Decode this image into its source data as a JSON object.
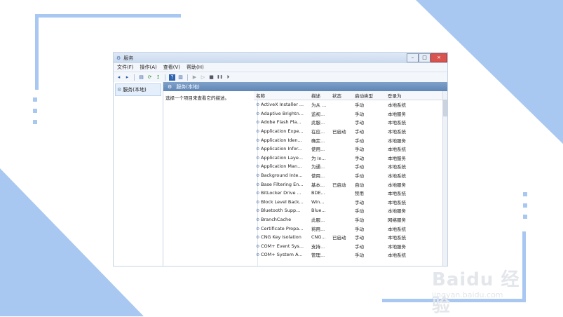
{
  "window": {
    "title": "服务",
    "controls": {
      "minimize": "–",
      "maximize": "□",
      "close": "×"
    }
  },
  "menu": [
    "文件(F)",
    "操作(A)",
    "查看(V)",
    "帮助(H)"
  ],
  "toolbar": {
    "icons": [
      "back-icon",
      "forward-icon",
      "console-tree-icon",
      "refresh-icon",
      "export-icon",
      "help-icon",
      "properties-icon",
      "start-icon",
      "play-icon",
      "stop-icon",
      "pause-icon",
      "restart-icon"
    ],
    "glyphs": {
      "back": "◂",
      "forward": "▸",
      "tree": "▤",
      "refresh": "⟳",
      "export": "↥",
      "help": "?",
      "props": "▥",
      "play": "▶",
      "play2": "▷",
      "stop": "■",
      "pause": "❚❚",
      "restart": "⏵"
    }
  },
  "left_pane": {
    "tree_item": "服务(本地)"
  },
  "right_pane": {
    "header": "服务(本地)",
    "description": "选择一个项目来查看它的描述。",
    "columns": [
      "名称",
      "描述",
      "状态",
      "启动类型",
      "登录为"
    ],
    "rows": [
      {
        "name": "ActiveX Installer ...",
        "desc": "为从 ...",
        "status": "",
        "start": "手动",
        "logon": "本地系统"
      },
      {
        "name": "Adaptive Brightn...",
        "desc": "监视...",
        "status": "",
        "start": "手动",
        "logon": "本地服务"
      },
      {
        "name": "Adobe Flash Pla...",
        "desc": "此服...",
        "status": "",
        "start": "手动",
        "logon": "本地系统"
      },
      {
        "name": "Application Expe...",
        "desc": "在应...",
        "status": "已启动",
        "start": "手动",
        "logon": "本地系统"
      },
      {
        "name": "Application Iden...",
        "desc": "确定...",
        "status": "",
        "start": "手动",
        "logon": "本地服务"
      },
      {
        "name": "Application Infor...",
        "desc": "使用...",
        "status": "",
        "start": "手动",
        "logon": "本地系统"
      },
      {
        "name": "Application Laye...",
        "desc": "为 In...",
        "status": "",
        "start": "手动",
        "logon": "本地服务"
      },
      {
        "name": "Application Man...",
        "desc": "为通...",
        "status": "",
        "start": "手动",
        "logon": "本地系统"
      },
      {
        "name": "Background Inte...",
        "desc": "使用...",
        "status": "",
        "start": "手动",
        "logon": "本地系统"
      },
      {
        "name": "Base Filtering En...",
        "desc": "基本...",
        "status": "已启动",
        "start": "自动",
        "logon": "本地服务"
      },
      {
        "name": "BitLocker Drive ...",
        "desc": "BDE...",
        "status": "",
        "start": "禁用",
        "logon": "本地系统"
      },
      {
        "name": "Block Level Back...",
        "desc": "Win...",
        "status": "",
        "start": "手动",
        "logon": "本地系统"
      },
      {
        "name": "Bluetooth Supp...",
        "desc": "Blue...",
        "status": "",
        "start": "手动",
        "logon": "本地服务"
      },
      {
        "name": "BranchCache",
        "desc": "此服...",
        "status": "",
        "start": "手动",
        "logon": "网络服务"
      },
      {
        "name": "Certificate Propa...",
        "desc": "将用...",
        "status": "",
        "start": "手动",
        "logon": "本地系统"
      },
      {
        "name": "CNG Key Isolation",
        "desc": "CNG...",
        "status": "已启动",
        "start": "手动",
        "logon": "本地系统"
      },
      {
        "name": "COM+ Event Sys...",
        "desc": "支持...",
        "status": "",
        "start": "手动",
        "logon": "本地服务"
      },
      {
        "name": "COM+ System A...",
        "desc": "管理...",
        "status": "",
        "start": "手动",
        "logon": "本地系统"
      }
    ]
  },
  "watermark": {
    "brand": "Baidu 经验",
    "url": "jingyan.baidu.com"
  },
  "colors": {
    "accent": "#a8c8f2",
    "header": "#6a8fbe"
  }
}
